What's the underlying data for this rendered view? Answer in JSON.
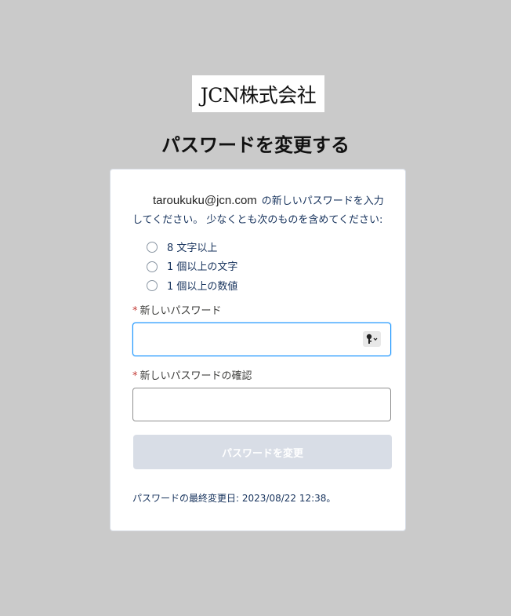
{
  "logo": {
    "text": "JCN株式会社"
  },
  "page_title": "パスワードを変更する",
  "intro": {
    "email": "taroukuku@jcn.com",
    "text": "の新しいパスワードを入力してください。 少なくとも次のものを含めてください:"
  },
  "requirements": [
    {
      "label": "8 文字以上"
    },
    {
      "label": "1 個以上の文字"
    },
    {
      "label": "1 個以上の数値"
    }
  ],
  "fields": {
    "new_password": {
      "required_mark": "*",
      "label": "新しいパスワード",
      "value": "",
      "icon": "key-icon"
    },
    "confirm_password": {
      "required_mark": "*",
      "label": "新しいパスワードの確認",
      "value": ""
    }
  },
  "submit_label": "パスワードを変更",
  "last_changed": "パスワードの最終変更日: 2023/08/22 12:38。",
  "colors": {
    "background": "#cacaca",
    "focus_border": "#1b96ff",
    "required": "#c23934",
    "disabled_button": "#d8dde6"
  }
}
